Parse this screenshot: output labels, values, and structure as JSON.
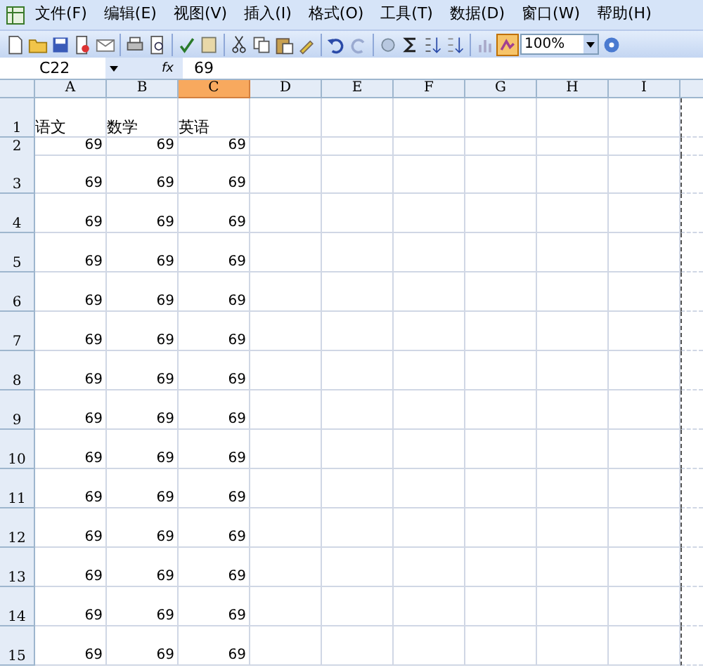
{
  "menu": [
    "文件(F)",
    "编辑(E)",
    "视图(V)",
    "插入(I)",
    "格式(O)",
    "工具(T)",
    "数据(D)",
    "窗口(W)",
    "帮助(H)"
  ],
  "toolbar": {
    "zoom": "100%",
    "drawing_on": true
  },
  "formula_bar": {
    "name_box": "C22",
    "fx": "fx",
    "value": "69"
  },
  "columns": [
    {
      "label": "A",
      "selected": false
    },
    {
      "label": "B",
      "selected": false
    },
    {
      "label": "C",
      "selected": true
    },
    {
      "label": "D",
      "selected": false
    },
    {
      "label": "E",
      "selected": false
    },
    {
      "label": "F",
      "selected": false
    },
    {
      "label": "G",
      "selected": false
    },
    {
      "label": "H",
      "selected": false
    },
    {
      "label": "I",
      "selected": false
    }
  ],
  "rows": [
    {
      "label": "1",
      "cells": [
        "语文",
        "数学",
        "英语"
      ]
    },
    {
      "label": "2",
      "cells": [
        "69",
        "69",
        "69"
      ]
    },
    {
      "label": "3",
      "cells": [
        "69",
        "69",
        "69"
      ]
    },
    {
      "label": "4",
      "cells": [
        "69",
        "69",
        "69"
      ]
    },
    {
      "label": "5",
      "cells": [
        "69",
        "69",
        "69"
      ]
    },
    {
      "label": "6",
      "cells": [
        "69",
        "69",
        "69"
      ]
    },
    {
      "label": "7",
      "cells": [
        "69",
        "69",
        "69"
      ]
    },
    {
      "label": "8",
      "cells": [
        "69",
        "69",
        "69"
      ]
    },
    {
      "label": "9",
      "cells": [
        "69",
        "69",
        "69"
      ]
    },
    {
      "label": "10",
      "cells": [
        "69",
        "69",
        "69"
      ]
    },
    {
      "label": "11",
      "cells": [
        "69",
        "69",
        "69"
      ]
    },
    {
      "label": "12",
      "cells": [
        "69",
        "69",
        "69"
      ]
    },
    {
      "label": "13",
      "cells": [
        "69",
        "69",
        "69"
      ]
    },
    {
      "label": "14",
      "cells": [
        "69",
        "69",
        "69"
      ]
    },
    {
      "label": "15",
      "cells": [
        "69",
        "69",
        "69"
      ]
    }
  ]
}
